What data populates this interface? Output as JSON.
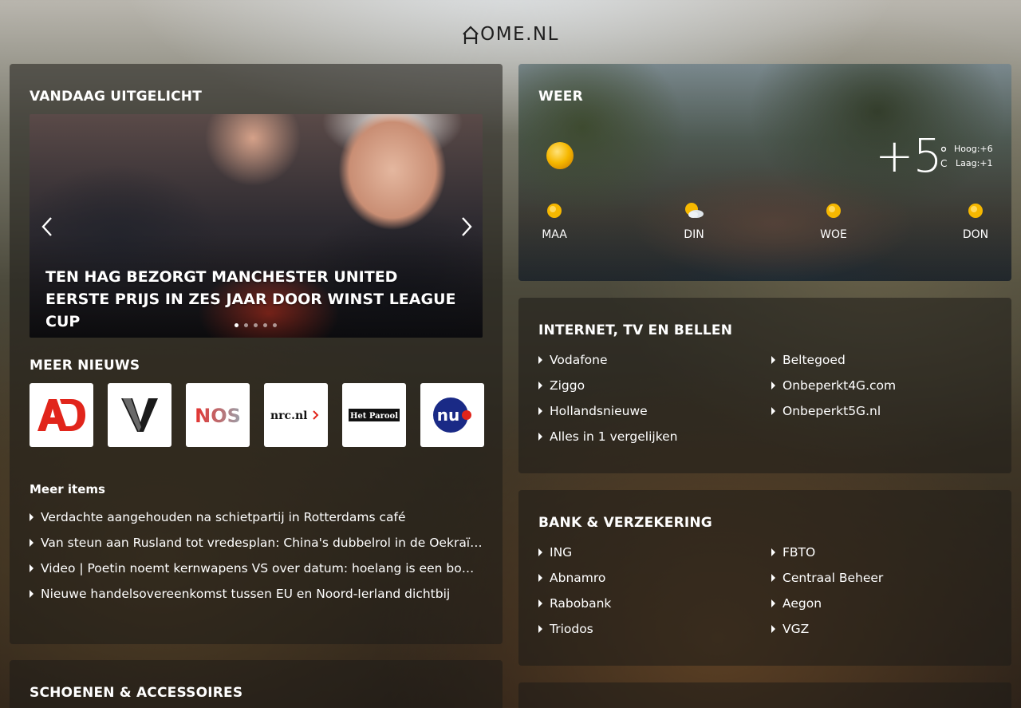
{
  "site": {
    "logo_text": "OME.NL"
  },
  "featured": {
    "title": "VANDAAG UITGELICHT",
    "headline": "TEN HAG BEZORGT MANCHESTER UNITED EERSTE PRIJS IN ZES JAAR DOOR WINST LEAGUE CUP",
    "slide_count": 5,
    "active_slide": 1
  },
  "more_news": {
    "title": "MEER NIEUWS",
    "sources": [
      {
        "name": "AD",
        "icon": "ad-logo"
      },
      {
        "name": "V",
        "icon": "volkskrant-logo"
      },
      {
        "name": "NOS",
        "icon": "nos-logo"
      },
      {
        "name": "nrc.nl",
        "icon": "nrc-logo"
      },
      {
        "name": "Het Parool",
        "icon": "parool-logo"
      },
      {
        "name": "nu",
        "icon": "nu-logo"
      }
    ],
    "items_heading": "Meer items",
    "items": [
      "Verdachte aangehouden na schietpartij in Rotterdams café",
      "Van steun aan Rusland tot vredesplan: China's dubbelrol in de Oekraïne-oorlog",
      "Video | Poetin noemt kernwapens VS over datum: hoelang is een bom houdbaar?",
      "Nieuwe handelsovereenkomst tussen EU en Noord-Ierland dichtbij"
    ]
  },
  "shoes": {
    "title": "SCHOENEN & ACCESSOIRES"
  },
  "weather": {
    "title": "WEER",
    "current_temp": "+5",
    "degree_symbol": "°",
    "unit": "C",
    "high": "Hoog:+6",
    "low": "Laag:+1",
    "forecast": [
      {
        "day": "MAA",
        "icon": "sun-icon"
      },
      {
        "day": "DIN",
        "icon": "sun-cloud-icon"
      },
      {
        "day": "WOE",
        "icon": "sun-icon"
      },
      {
        "day": "DON",
        "icon": "sun-icon"
      }
    ]
  },
  "internet": {
    "title": "INTERNET, TV EN BELLEN",
    "col1": [
      "Vodafone",
      "Ziggo",
      "Hollandsnieuwe",
      "Alles in 1 vergelijken"
    ],
    "col2": [
      "Beltegoed",
      "Onbeperkt4G.com",
      "Onbeperkt5G.nl"
    ]
  },
  "bank": {
    "title": "BANK & VERZEKERING",
    "col1": [
      "ING",
      "Abnamro",
      "Rabobank",
      "Triodos"
    ],
    "col2": [
      "FBTO",
      "Centraal Beheer",
      "Aegon",
      "VGZ"
    ]
  },
  "colors": {
    "sun": "#f6b800",
    "ad_red": "#e1251b",
    "nu_blue": "#1a2a86",
    "nos_red": "#e5312e"
  }
}
